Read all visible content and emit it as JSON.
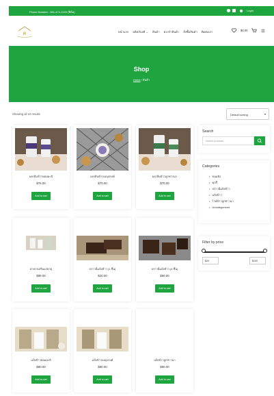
{
  "topbar": {
    "phone": "Phone Number : 081-474-1139 (ฟิล์ม)",
    "login": "Login"
  },
  "nav": {
    "items": [
      "หน้าแรก",
      "ผลิตภัณฑ์ ⌄",
      "สินค้า",
      "ตะกร้าสินค้า",
      "สั่งซื้อสินค้า",
      "ติดต่อเรา"
    ],
    "cart_total": "$0.00"
  },
  "hero": {
    "title": "Shop",
    "crumb_home": "Home",
    "crumb_current": "สินค้า"
  },
  "listing": {
    "results_text": "Showing all 10 results",
    "sort_label": "Default sorting"
  },
  "products": [
    {
      "name": "ผงกลิ่นข้าวหอมมะลิ",
      "price": "$75.00",
      "button": "Add to cart"
    },
    {
      "name": "ผงกลิ่นข้าวเบญจรงค์",
      "price": "$70.00",
      "button": "Add to cart"
    },
    {
      "name": "ผงกลิ่นข้าวลูกชาวนา",
      "price": "$70.00",
      "button": "Add to cart"
    },
    {
      "name": "อาหารเสริมแร่ธาตุ",
      "price": "$99.00",
      "button": "Add to cart"
    },
    {
      "name": "บราวนี่แป้งข้าว (1 ชิ้น)",
      "price": "$20.00",
      "button": "Add to cart"
    },
    {
      "name": "บราวนี่แป้งข้าว (4 ชิ้น)",
      "price": "$50.00",
      "button": "Add to cart"
    },
    {
      "name": "แป้งข้าวหอมมะลิ",
      "price": "$80.00",
      "button": "Add to cart"
    },
    {
      "name": "แป้งข้าวเบญจรงค์",
      "price": "$80.00",
      "button": "Add to cart"
    },
    {
      "name": "แป้งข้าวลูกชาวนา",
      "price": "$80.00",
      "button": "Add to cart"
    }
  ],
  "sidebar": {
    "search_title": "Search",
    "search_placeholder": "Search products...",
    "categories_title": "Categories",
    "categories": [
      "ขนมปัง",
      "คุกกี้",
      "บราวนี่แป้งข้าว",
      "แป้งข้าว",
      "ไวน์ข้าวลูกชาวนา",
      "Uncategorized"
    ],
    "filter_title": "Filter by price",
    "price_min": "$20",
    "price_max": "$100"
  },
  "colors": {
    "brand_green": "#1fa540"
  }
}
